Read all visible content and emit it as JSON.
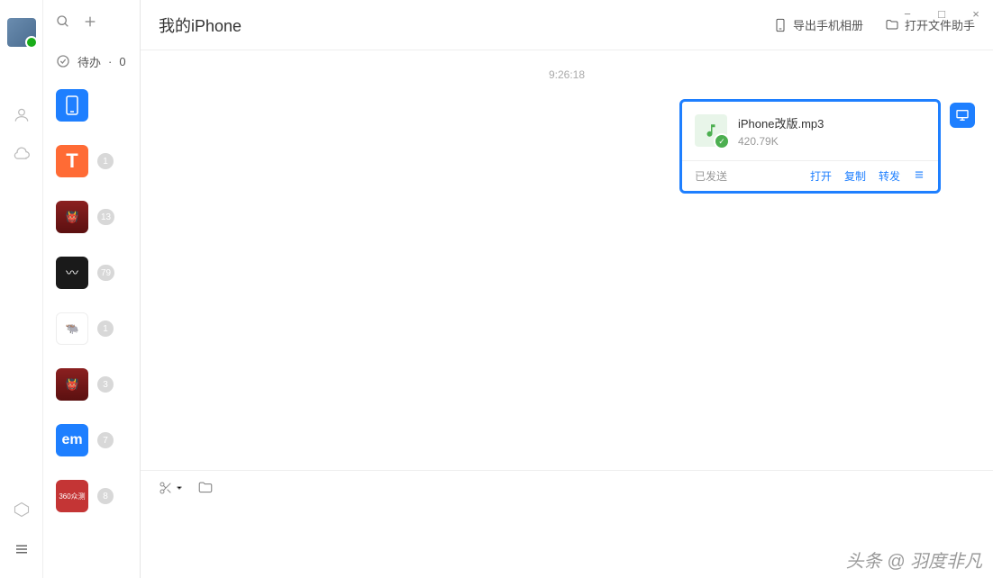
{
  "window": {
    "minimize": "−",
    "maximize": "□",
    "close": "×"
  },
  "contacts_header": {
    "todo_label": "待办",
    "todo_count": "0"
  },
  "contacts": [
    {
      "badge": null,
      "avatar_class": "phone",
      "is_selected": true
    },
    {
      "badge": "1",
      "avatar_class": "orange",
      "letter": "T"
    },
    {
      "badge": "13",
      "avatar_class": "red",
      "letter": ""
    },
    {
      "badge": "79",
      "avatar_class": "dark",
      "letter": "⚡"
    },
    {
      "badge": "1",
      "avatar_class": "white",
      "letter": ""
    },
    {
      "badge": "3",
      "avatar_class": "red",
      "letter": ""
    },
    {
      "badge": "7",
      "avatar_class": "blue",
      "letter": "em"
    },
    {
      "badge": "8",
      "avatar_class": "red2",
      "letter": "360众测"
    }
  ],
  "header": {
    "title": "我的iPhone",
    "export_album": "导出手机相册",
    "open_file_helper": "打开文件助手"
  },
  "chat": {
    "timestamp": "9:26:18",
    "file": {
      "name": "iPhone改版.mp3",
      "size": "420.79K",
      "status": "已发送",
      "action_open": "打开",
      "action_copy": "复制",
      "action_forward": "转发"
    }
  },
  "watermark": "头条 @ 羽度非凡"
}
